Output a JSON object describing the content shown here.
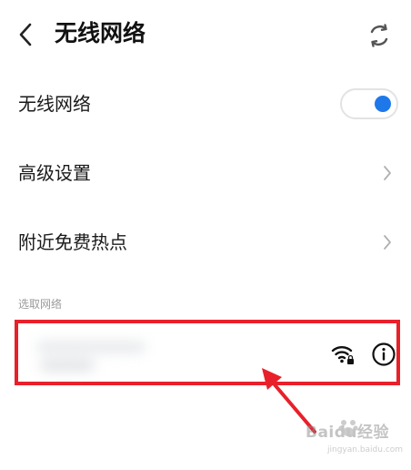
{
  "header": {
    "title": "无线网络",
    "back_icon": "chevron-left-icon",
    "refresh_icon": "refresh-icon"
  },
  "rows": [
    {
      "label": "无线网络",
      "control": "toggle",
      "toggle_on": true
    },
    {
      "label": "高级设置",
      "control": "chevron"
    },
    {
      "label": "附近免费热点",
      "control": "chevron"
    }
  ],
  "section": {
    "label": "选取网络"
  },
  "network": {
    "name_obscured": true,
    "icons": [
      "wifi-locked-icon",
      "info-icon"
    ]
  },
  "annotation": {
    "highlight_color": "#e8202a",
    "arrow_color": "#e8202a"
  },
  "watermark": {
    "text": "Baidu经验",
    "sub": "jingyan.baidu.com"
  },
  "colors": {
    "accent": "#1e78ea",
    "highlight": "#e8202a"
  }
}
